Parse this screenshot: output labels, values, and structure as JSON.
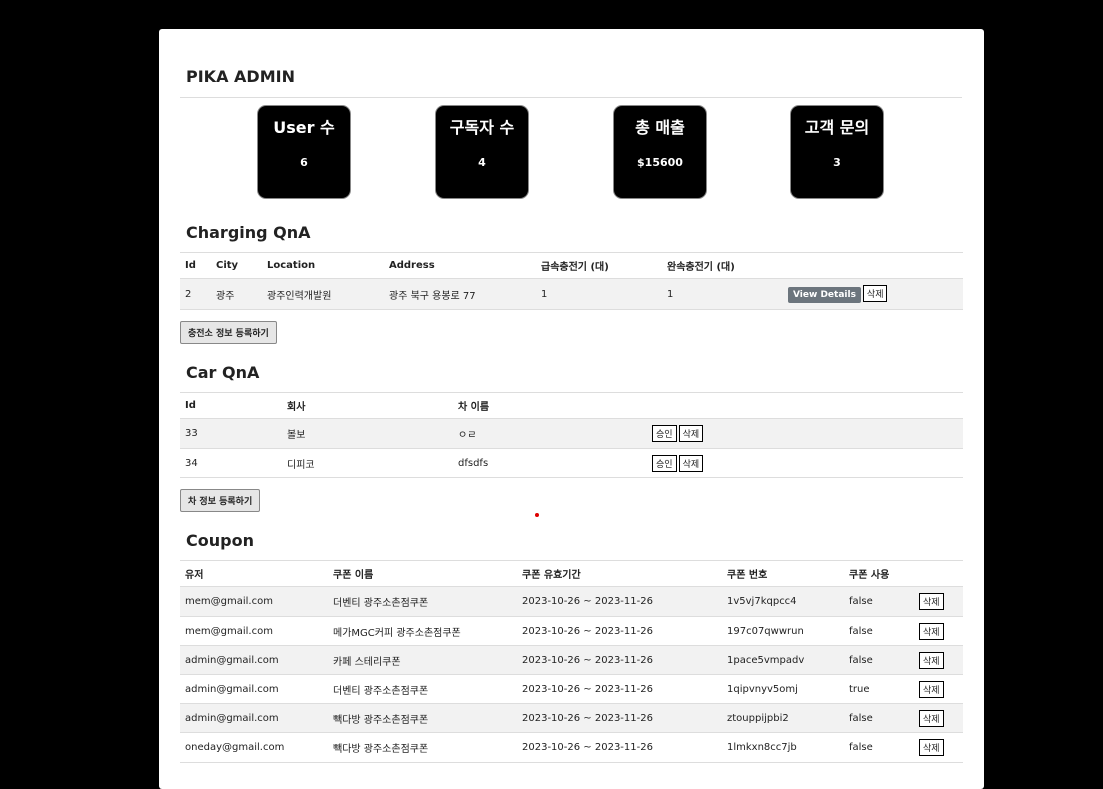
{
  "brand": "PIKA ADMIN",
  "stats": [
    {
      "label": "User 수",
      "value": "6"
    },
    {
      "label": "구독자 수",
      "value": "4"
    },
    {
      "label": "총 매출",
      "value": "$15600"
    },
    {
      "label": "고객 문의",
      "value": "3"
    }
  ],
  "charging": {
    "title": "Charging QnA",
    "headers": [
      "Id",
      "City",
      "Location",
      "Address",
      "급속충전기 (대)",
      "완속충전기 (대)"
    ],
    "rows": [
      {
        "id": "2",
        "city": "광주",
        "location": "광주인력개발원",
        "address": "광주 북구 용봉로 77",
        "fast": "1",
        "slow": "1"
      }
    ],
    "view_label": "View Details",
    "delete_label": "삭제",
    "register_label": "충전소 정보 등록하기"
  },
  "car": {
    "title": "Car QnA",
    "headers": [
      "Id",
      "회사",
      "차 이름"
    ],
    "rows": [
      {
        "id": "33",
        "company": "볼보",
        "name": "ㅇㄹ"
      },
      {
        "id": "34",
        "company": "디피코",
        "name": "dfsdfs"
      }
    ],
    "approve_label": "승인",
    "delete_label": "삭제",
    "register_label": "차 정보 등록하기"
  },
  "coupon": {
    "title": "Coupon",
    "headers": [
      "유저",
      "쿠폰 이름",
      "쿠폰 유효기간",
      "쿠폰 번호",
      "쿠폰 사용"
    ],
    "rows": [
      {
        "user": "mem@gmail.com",
        "name": "더벤티 광주소촌점쿠폰",
        "period": "2023-10-26 ~ 2023-11-26",
        "code": "1v5vj7kqpcc4",
        "used": "false"
      },
      {
        "user": "mem@gmail.com",
        "name": "메가MGC커피 광주소촌점쿠폰",
        "period": "2023-10-26 ~ 2023-11-26",
        "code": "197c07qwwrun",
        "used": "false"
      },
      {
        "user": "admin@gmail.com",
        "name": "카페 스테리쿠폰",
        "period": "2023-10-26 ~ 2023-11-26",
        "code": "1pace5vmpadv",
        "used": "false"
      },
      {
        "user": "admin@gmail.com",
        "name": "더벤티 광주소촌점쿠폰",
        "period": "2023-10-26 ~ 2023-11-26",
        "code": "1qipvnyv5omj",
        "used": "true"
      },
      {
        "user": "admin@gmail.com",
        "name": "빽다방 광주소촌점쿠폰",
        "period": "2023-10-26 ~ 2023-11-26",
        "code": "ztouppijpbi2",
        "used": "false"
      },
      {
        "user": "oneday@gmail.com",
        "name": "빽다방 광주소촌점쿠폰",
        "period": "2023-10-26 ~ 2023-11-26",
        "code": "1lmkxn8cc7jb",
        "used": "false"
      }
    ],
    "delete_label": "삭제"
  }
}
